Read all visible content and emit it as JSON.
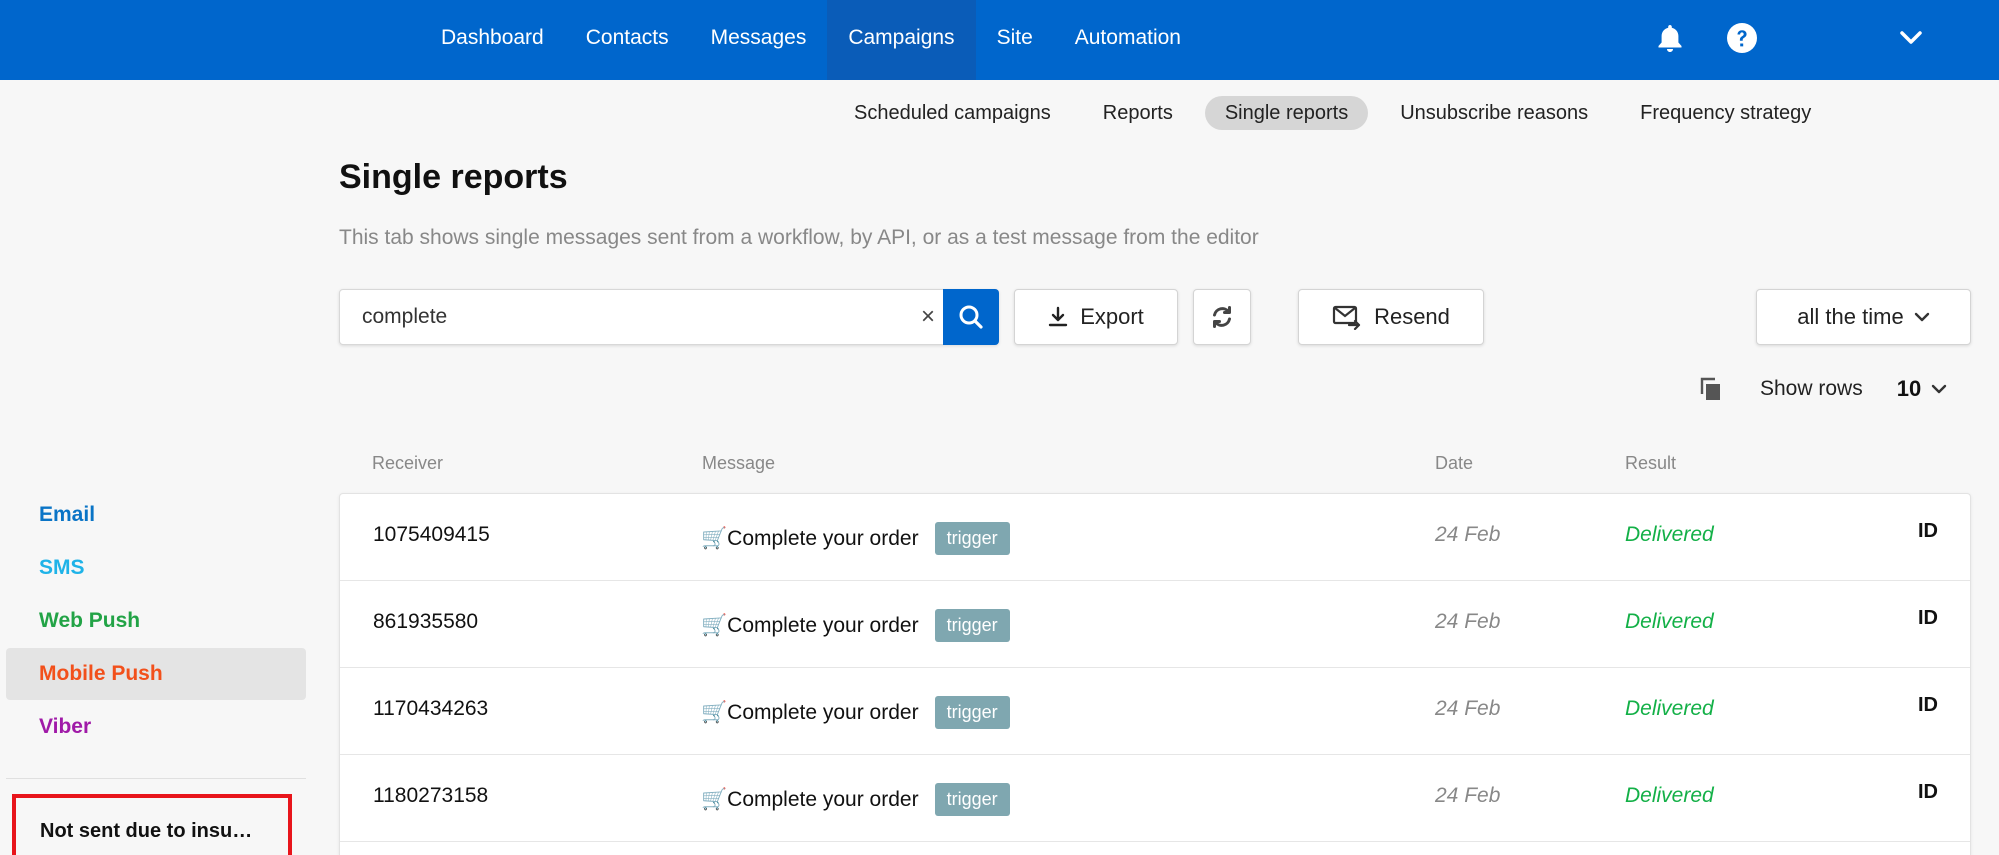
{
  "nav": {
    "items": [
      {
        "label": "Dashboard"
      },
      {
        "label": "Contacts"
      },
      {
        "label": "Messages"
      },
      {
        "label": "Campaigns",
        "active": true
      },
      {
        "label": "Site"
      },
      {
        "label": "Automation"
      }
    ],
    "icons": [
      "bell-icon",
      "help-icon",
      "chevron-down-icon"
    ]
  },
  "subnav": {
    "items": [
      {
        "label": "Scheduled campaigns"
      },
      {
        "label": "Reports"
      },
      {
        "label": "Single reports",
        "active": true
      },
      {
        "label": "Unsubscribe reasons"
      },
      {
        "label": "Frequency strategy"
      }
    ]
  },
  "page": {
    "title": "Single reports",
    "description": "This tab shows single messages sent from a workflow, by API, or as a test message from the editor"
  },
  "toolbar": {
    "search_value": "complete",
    "clear_label": "×",
    "export_label": "Export",
    "resend_label": "Resend",
    "period_label": "all the time",
    "show_rows_label": "Show rows",
    "rows_value": "10"
  },
  "sidebar": {
    "items": [
      {
        "label": "Email",
        "color": "#0a74c6"
      },
      {
        "label": "SMS",
        "color": "#1fb3e8"
      },
      {
        "label": "Web Push",
        "color": "#22a346"
      },
      {
        "label": "Mobile Push",
        "color": "#f2501b",
        "active": true
      },
      {
        "label": "Viber",
        "color": "#a01aa8"
      }
    ],
    "alert_label": "Not sent due to insu…"
  },
  "table": {
    "headers": {
      "receiver": "Receiver",
      "message": "Message",
      "date": "Date",
      "result": "Result"
    },
    "rows": [
      {
        "receiver": "1075409415",
        "message": "🛒Complete your order",
        "tag": "trigger",
        "date": "24 Feb",
        "result": "Delivered",
        "id": "ID"
      },
      {
        "receiver": "861935580",
        "message": "🛒Complete your order",
        "tag": "trigger",
        "date": "24 Feb",
        "result": "Delivered",
        "id": "ID"
      },
      {
        "receiver": "1170434263",
        "message": "🛒Complete your order",
        "tag": "trigger",
        "date": "24 Feb",
        "result": "Delivered",
        "id": "ID"
      },
      {
        "receiver": "1180273158",
        "message": "🛒Complete your order",
        "tag": "trigger",
        "date": "24 Feb",
        "result": "Delivered",
        "id": "ID"
      }
    ]
  },
  "colors": {
    "brand": "#0066cc",
    "delivered": "#13b047",
    "tag": "#7fa7b0",
    "alert_border": "#e8151b"
  }
}
